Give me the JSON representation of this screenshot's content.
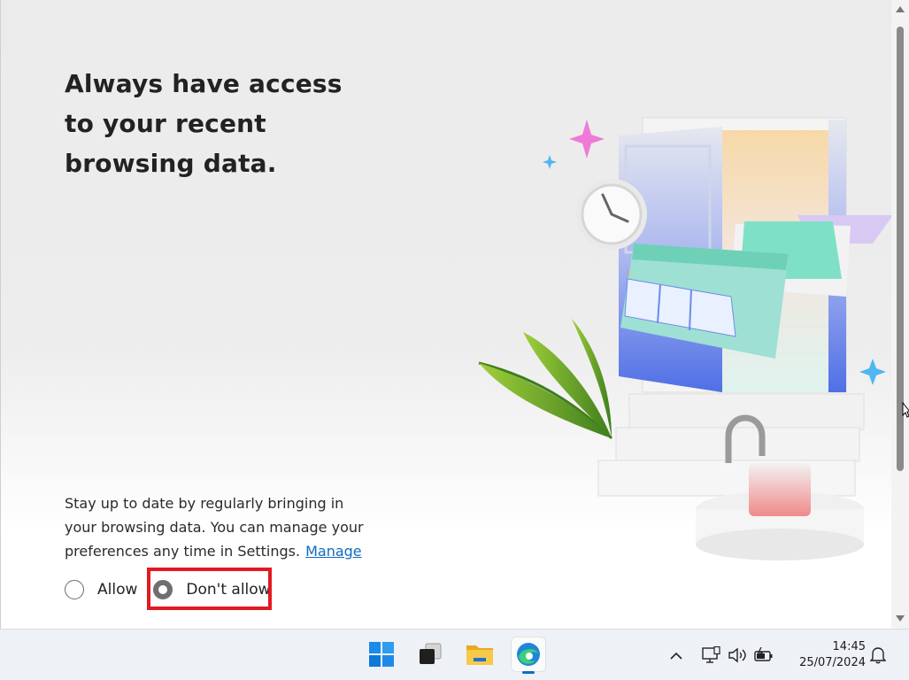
{
  "page": {
    "headline": "Always have access to your recent browsing data.",
    "description": "Stay up to date by regularly bringing in your browsing data. You can manage your preferences any time in Settings.",
    "manage_link": "Manage",
    "options": [
      {
        "label": "Allow",
        "selected": false
      },
      {
        "label": "Don't allow",
        "selected": true
      }
    ],
    "highlight_color": "#e01a22",
    "link_color": "#0f6cbd"
  },
  "taskbar": {
    "apps": [
      {
        "name": "start",
        "icon": "windows-logo-icon"
      },
      {
        "name": "task-view",
        "icon": "task-view-icon"
      },
      {
        "name": "file-explorer",
        "icon": "folder-icon"
      },
      {
        "name": "edge",
        "icon": "edge-browser-icon",
        "active": true
      }
    ],
    "tray": [
      "chevron-up-icon",
      "network-icon",
      "volume-icon",
      "battery-icon",
      "notification-bell-icon"
    ],
    "time": "14:45",
    "date": "25/07/2024"
  }
}
